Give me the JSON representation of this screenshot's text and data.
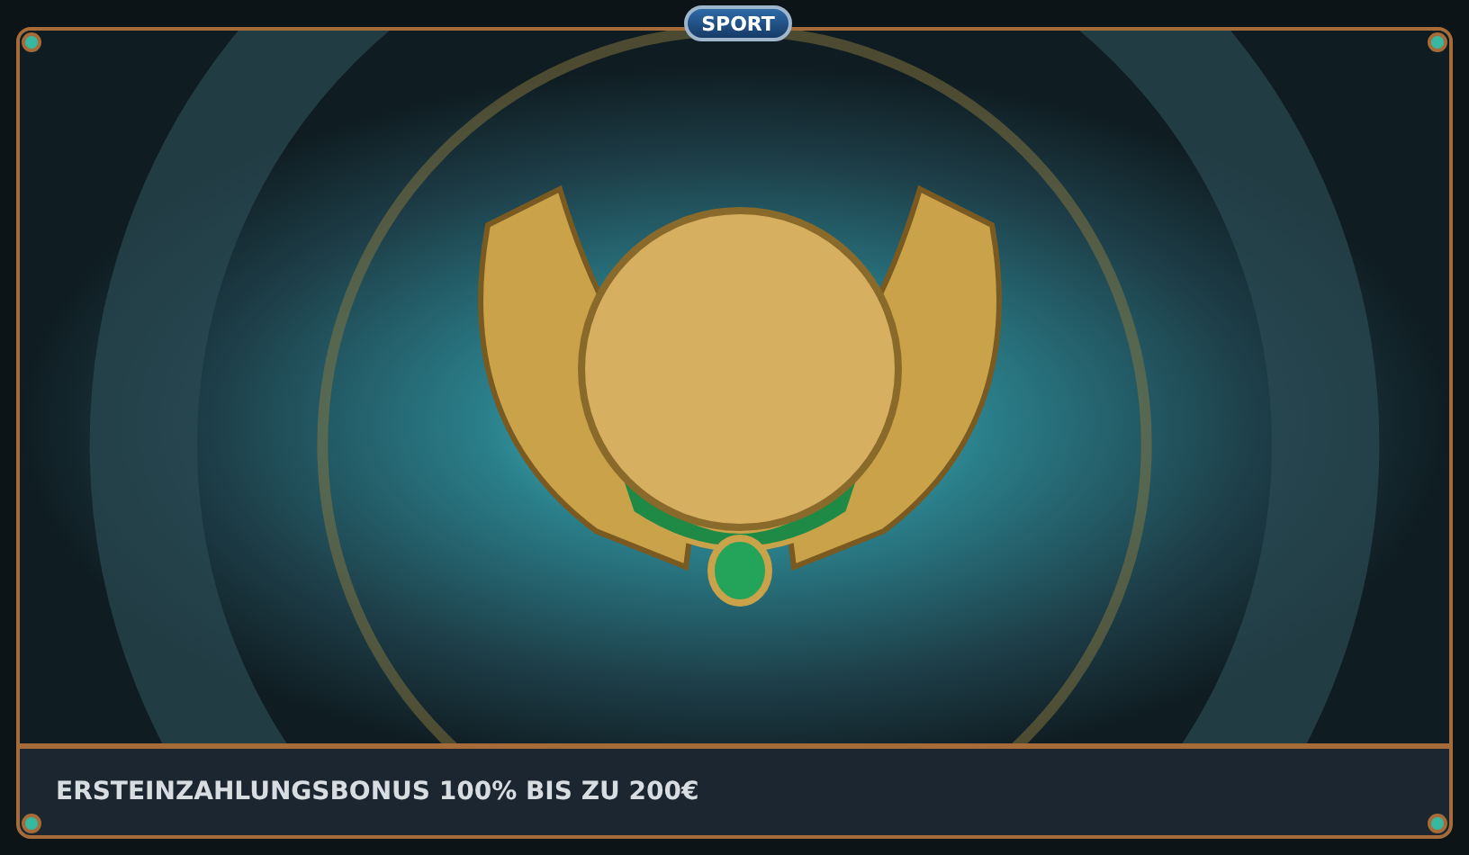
{
  "badge": {
    "label": "SPORT"
  },
  "banner": {
    "caption": "ERSTEINZAHLUNGSBONUS 100% BIS ZU 200€"
  }
}
